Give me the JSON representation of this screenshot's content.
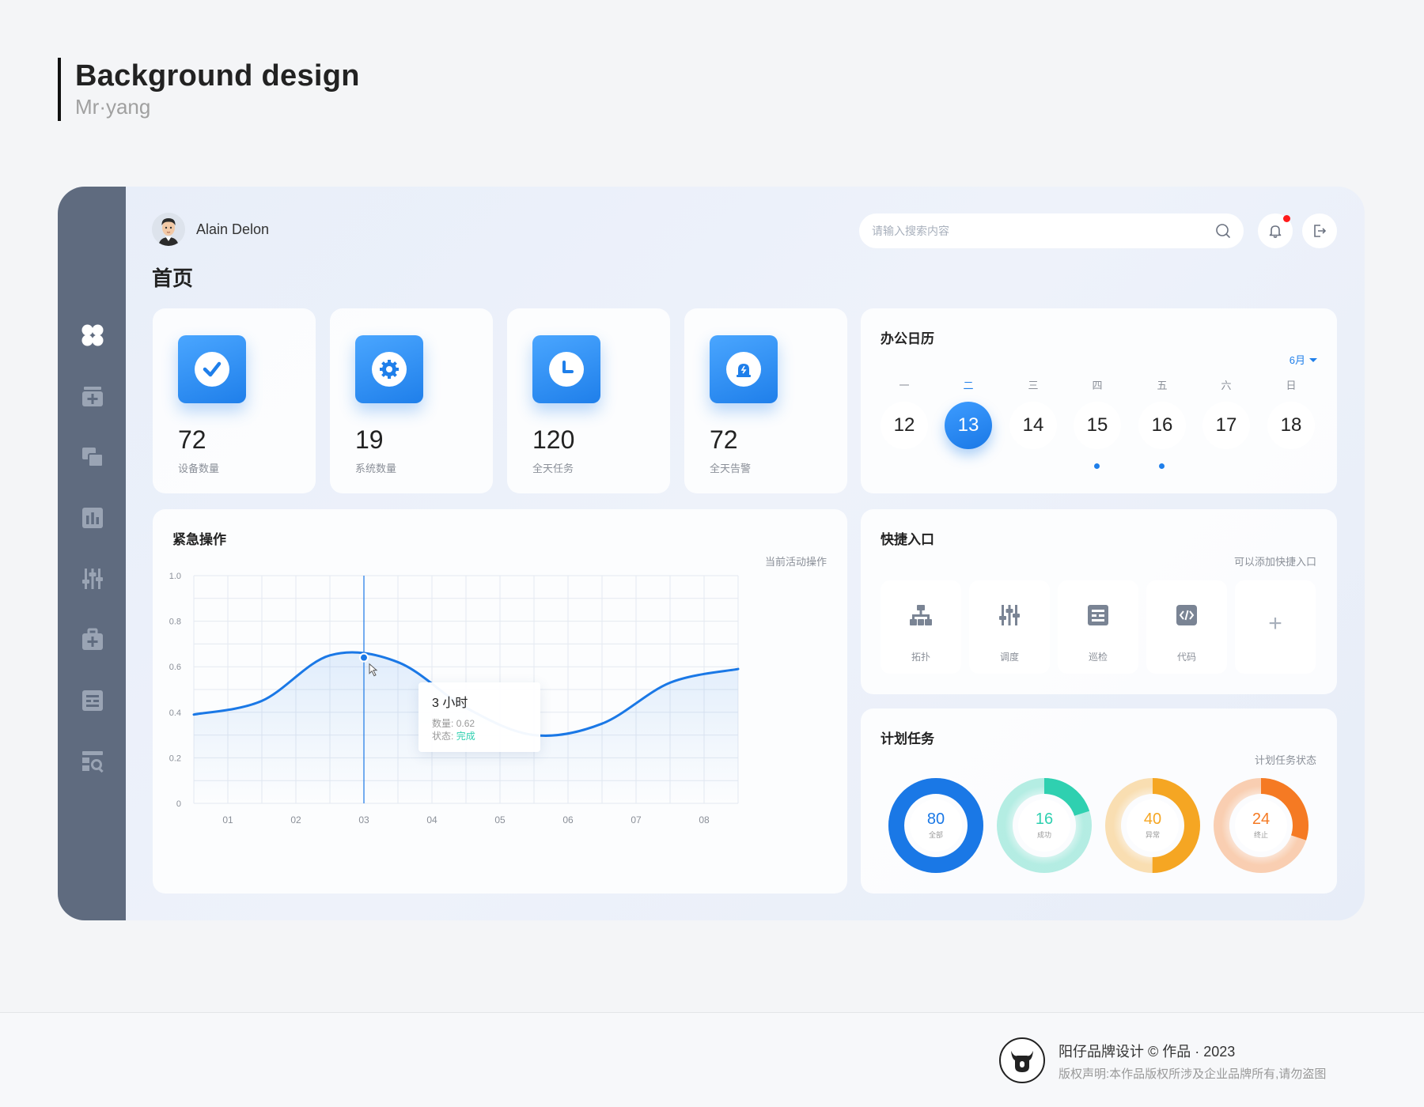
{
  "heading": {
    "title": "Background design",
    "subtitle": "Mr·yang"
  },
  "user": {
    "name": "Alain Delon"
  },
  "page": {
    "title": "首页"
  },
  "search": {
    "placeholder": "请输入搜索内容"
  },
  "sidebar": {
    "items": [
      {
        "icon": "dashboard-icon",
        "active": true
      },
      {
        "icon": "add-box-icon"
      },
      {
        "icon": "layers-icon"
      },
      {
        "icon": "bar-chart-icon"
      },
      {
        "icon": "sliders-icon"
      },
      {
        "icon": "medical-kit-icon"
      },
      {
        "icon": "list-card-icon"
      },
      {
        "icon": "search-report-icon"
      }
    ]
  },
  "stats": [
    {
      "value": "72",
      "label": "设备数量",
      "icon": "check-icon"
    },
    {
      "value": "19",
      "label": "系统数量",
      "icon": "gear-icon"
    },
    {
      "value": "120",
      "label": "全天任务",
      "icon": "clock-icon"
    },
    {
      "value": "72",
      "label": "全天告警",
      "icon": "alarm-icon"
    }
  ],
  "calendar": {
    "title": "办公日历",
    "month": "6月",
    "weekdays": [
      "一",
      "二",
      "三",
      "四",
      "五",
      "六",
      "日"
    ],
    "days": [
      "12",
      "13",
      "14",
      "15",
      "16",
      "17",
      "18"
    ],
    "selected_index": 1,
    "event_days": [
      "15",
      "16"
    ]
  },
  "emergency": {
    "title": "紧急操作",
    "hint": "当前活动操作",
    "tooltip": {
      "title": "3 小时",
      "qty_label": "数量:",
      "qty_value": "0.62",
      "status_label": "状态:",
      "status_value": "完成"
    },
    "chart_data": {
      "type": "line",
      "categories": [
        "01",
        "02",
        "03",
        "04",
        "05",
        "06",
        "07",
        "08"
      ],
      "x": [
        0,
        1,
        2,
        3,
        4,
        5,
        6,
        7,
        8
      ],
      "y": [
        0.39,
        0.45,
        0.65,
        0.62,
        0.42,
        0.3,
        0.35,
        0.53,
        0.59
      ],
      "yticks": [
        "0",
        "0.2",
        "0.4",
        "0.6",
        "0.8",
        "1.0"
      ],
      "ylim": [
        0,
        1
      ],
      "highlight_x": 2.5,
      "color": "#1a78e6",
      "grid": true
    }
  },
  "quick": {
    "title": "快捷入口",
    "hint": "可以添加快捷入口",
    "items": [
      {
        "label": "拓扑",
        "icon": "topology-icon"
      },
      {
        "label": "调度",
        "icon": "sliders-icon"
      },
      {
        "label": "巡检",
        "icon": "inspection-icon"
      },
      {
        "label": "代码",
        "icon": "code-icon"
      }
    ],
    "add_symbol": "+"
  },
  "plans": {
    "title": "计划任务",
    "hint": "计划任务状态",
    "rings": [
      {
        "value": "80",
        "label": "全部",
        "color": "#1a78e6",
        "fraction": 1.0
      },
      {
        "value": "16",
        "label": "成功",
        "color": "#2fd0b0",
        "fraction": 0.2
      },
      {
        "value": "40",
        "label": "异常",
        "color": "#f5a623",
        "fraction": 0.5
      },
      {
        "value": "24",
        "label": "终止",
        "color": "#f57a23",
        "fraction": 0.3
      }
    ]
  },
  "footer": {
    "line1": "阳仔品牌设计 © 作品 · 2023",
    "line2": "版权声明:本作品版权所涉及企业品牌所有,请勿盗图"
  }
}
